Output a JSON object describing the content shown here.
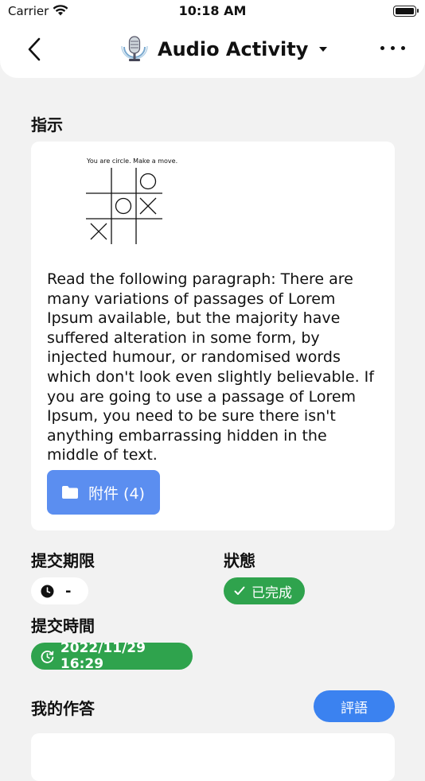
{
  "status_bar": {
    "carrier": "Carrier",
    "time": "10:18 AM"
  },
  "nav": {
    "title": "Audio Activity"
  },
  "instructions": {
    "label": "指示",
    "image_caption": "You are circle. Make a move.",
    "paragraph": "Read the following paragraph: There are many variations of passages of Lorem Ipsum available, but the majority have suffered alteration in some form, by injected humour, or randomised words which don't look even slightly believable. If you are going to use a passage of Lorem Ipsum, you need to be sure there isn't anything embarrassing hidden in the middle of text.",
    "attachment_label": "附件 (4)"
  },
  "deadline": {
    "label": "提交期限",
    "value": "-"
  },
  "status": {
    "label": "狀態",
    "value": "已完成",
    "color": "#2fa34d"
  },
  "submit_time": {
    "label": "提交時間",
    "value": "2022/11/29 16:29"
  },
  "my_answer": {
    "label": "我的作答",
    "comment_label": "評語"
  },
  "colors": {
    "accent_blue": "#3b82f0",
    "attachment_blue": "#5b8ef0",
    "success_green": "#2fa34d"
  }
}
